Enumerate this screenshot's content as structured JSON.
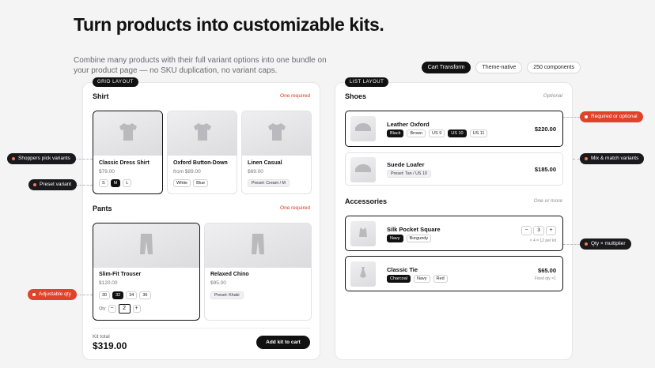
{
  "hero": {
    "title": "Turn products into customizable kits.",
    "subtitle": "Combine many products with their full variant options into one bundle on your product page — no SKU duplication, no variant caps."
  },
  "pills": [
    "Cart Transform",
    "Theme-native",
    "250 components"
  ],
  "grid": {
    "tag": "GRID LAYOUT",
    "shirt": {
      "title": "Shirt",
      "note": "One required",
      "products": [
        {
          "name": "Classic Dress Shirt",
          "price": "$79.00",
          "sizes": [
            "S",
            "M",
            "L"
          ],
          "selected_size": "M"
        },
        {
          "name": "Oxford Button-Down",
          "price": "from $89.00",
          "colors": [
            "White",
            "Blue"
          ]
        },
        {
          "name": "Linen Casual",
          "price": "$69.00",
          "preset": "Preset: Cream / M"
        }
      ]
    },
    "pants": {
      "title": "Pants",
      "note": "One required",
      "products": [
        {
          "name": "Slim-Fit Trouser",
          "price": "$120.00",
          "sizes": [
            "30",
            "32",
            "34",
            "36"
          ],
          "selected_size": "32",
          "qty_label": "Qty",
          "qty": "2",
          "minus": "−",
          "plus": "+"
        },
        {
          "name": "Relaxed Chino",
          "price": "$95.00",
          "preset": "Preset: Khaki"
        }
      ]
    },
    "kit_label": "Kit total",
    "kit_total": "$319.00",
    "cart_button": "Add kit to cart"
  },
  "list": {
    "tag": "LIST LAYOUT",
    "shoes": {
      "title": "Shoes",
      "note": "Optional",
      "items": [
        {
          "name": "Leather Oxford",
          "price": "$220.00",
          "colors": [
            "Black",
            "Brown"
          ],
          "selected_color": "Black",
          "sizes": [
            "US 9",
            "US 10",
            "US 11"
          ],
          "selected_size": "US 10"
        },
        {
          "name": "Suede Loafer",
          "price": "$185.00",
          "preset": "Preset: Tan / US 10"
        }
      ]
    },
    "accessories": {
      "title": "Accessories",
      "note": "One or more",
      "items": [
        {
          "name": "Silk Pocket Square",
          "colors": [
            "Navy",
            "Burgundy"
          ],
          "selected_color": "Navy",
          "qty": "3",
          "minus": "−",
          "plus": "+",
          "sub": "× 4 = 12 per kit"
        },
        {
          "name": "Classic Tie",
          "price": "$65.00",
          "colors": [
            "Charcoal",
            "Navy",
            "Red"
          ],
          "selected_color": "Charcoal",
          "sub": "Fixed qty ×1"
        }
      ]
    }
  },
  "callouts": {
    "shoppers": "Shoppers pick variants",
    "preset": "Preset variant",
    "adjustable": "Adjustable qty",
    "required": "Required or optional",
    "mix": "Mix & match variants",
    "qty": "Qty × multiplier"
  },
  "colors": {
    "accent": "#e0432a",
    "ink": "#111111",
    "panel": "#ffffff",
    "background": "#f4f4f5"
  },
  "icons": {
    "shirt": "shirt-icon",
    "pants": "pants-icon",
    "shoe": "shoe-icon",
    "pocket_square": "pocket-square-icon",
    "tie": "tie-icon"
  }
}
